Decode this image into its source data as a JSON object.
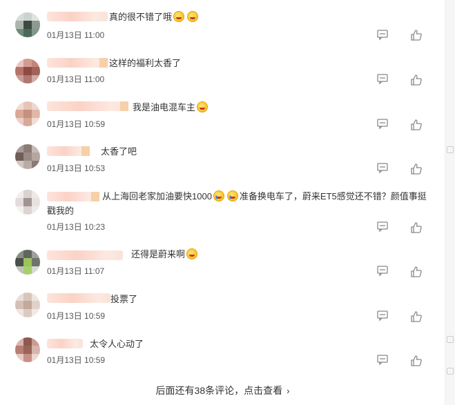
{
  "comments": [
    {
      "text_pre": "真的很不错了哦",
      "emojis": [
        "laugh-cry-emoji",
        "laugh-cry-emoji"
      ],
      "text_post": "",
      "time": "01月13日 11:00"
    },
    {
      "text_pre": "这样的福利太香了",
      "emojis": [],
      "text_post": "",
      "time": "01月13日 11:00"
    },
    {
      "text_pre": "我是油电混车主",
      "emojis": [
        "laughing-emoji"
      ],
      "text_post": "",
      "time": "01月13日 10:59"
    },
    {
      "text_pre": "太香了吧",
      "emojis": [],
      "text_post": "",
      "time": "01月13日 10:53"
    },
    {
      "text_pre": "从上海回老家加油要快1000",
      "emojis": [
        "crying-emoji",
        "crying-emoji"
      ],
      "text_post": "准备换电车了，蔚来ET5感觉还不错？颜值事挺戳我的",
      "time": "01月13日 10:23"
    },
    {
      "text_pre": "还得是蔚来啊",
      "emojis": [
        "wink-emoji"
      ],
      "text_post": "",
      "time": "01月13日 11:07"
    },
    {
      "text_pre": "投票了",
      "emojis": [],
      "text_post": "",
      "time": "01月13日 10:59"
    },
    {
      "text_pre": "太令人心动了",
      "emojis": [],
      "text_post": "",
      "time": "01月13日 10:59"
    }
  ],
  "footer": {
    "more_label": "后面还有38条评论，点击查看",
    "chevron": "›"
  },
  "icons": {
    "reply": "comment-icon",
    "like": "thumbs-up-icon"
  },
  "colors": {
    "text": "#333333",
    "time": "#555555",
    "icon": "#888888"
  }
}
